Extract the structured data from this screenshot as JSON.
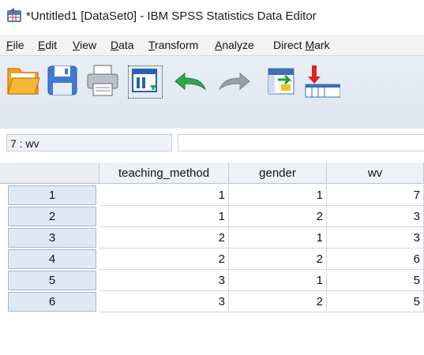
{
  "window": {
    "title": "*Untitled1 [DataSet0] - IBM SPSS Statistics Data Editor"
  },
  "menu": {
    "items": [
      {
        "label": "File",
        "u": "F"
      },
      {
        "label": "Edit",
        "u": "E"
      },
      {
        "label": "View",
        "u": "V"
      },
      {
        "label": "Data",
        "u": "D"
      },
      {
        "label": "Transform",
        "u": "T"
      },
      {
        "label": "Analyze",
        "u": "A"
      },
      {
        "label": "Direct Mark",
        "u": "M"
      }
    ]
  },
  "toolbar": {
    "icons": [
      "open-folder-icon",
      "save-icon",
      "print-icon",
      "recall-dialog-icon",
      "undo-icon",
      "redo-icon",
      "goto-case-icon",
      "insert-variable-icon"
    ]
  },
  "cellbar": {
    "reference": "7 : wv",
    "value": ""
  },
  "grid": {
    "columns": [
      "teaching_method",
      "gender",
      "wv"
    ],
    "rows": [
      {
        "num": "1",
        "cells": [
          "1",
          "1",
          "7"
        ]
      },
      {
        "num": "2",
        "cells": [
          "1",
          "2",
          "3"
        ]
      },
      {
        "num": "3",
        "cells": [
          "2",
          "1",
          "3"
        ]
      },
      {
        "num": "4",
        "cells": [
          "2",
          "2",
          "6"
        ]
      },
      {
        "num": "5",
        "cells": [
          "3",
          "1",
          "5"
        ]
      },
      {
        "num": "6",
        "cells": [
          "3",
          "2",
          "5"
        ]
      }
    ]
  },
  "colors": {
    "menubar": "#f3f3f3",
    "toolbar": "#e3e9f1",
    "rowheader": "#dfe9f6"
  }
}
